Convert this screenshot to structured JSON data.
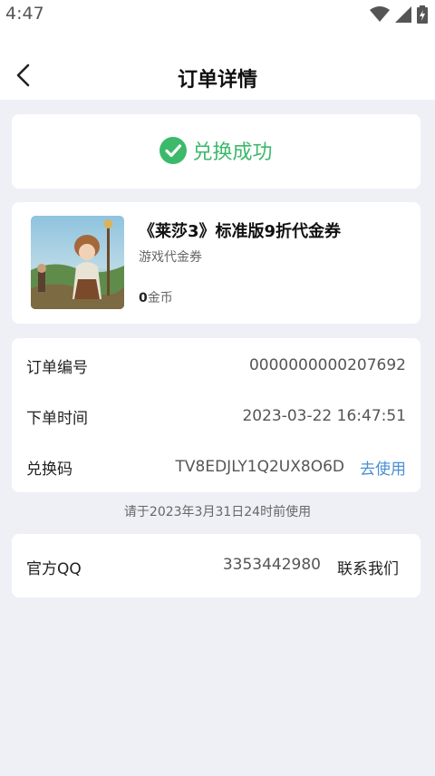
{
  "status_bar": {
    "time": "4:47"
  },
  "header": {
    "title": "订单详情"
  },
  "status": {
    "text": "兑换成功",
    "color": "#3cb96a"
  },
  "product": {
    "title": "《莱莎3》标准版9折代金券",
    "type": "游戏代金券",
    "price_amount": "0",
    "price_unit": "金币"
  },
  "order": {
    "number_label": "订单编号",
    "number_value": "0000000000207692",
    "time_label": "下单时间",
    "time_value": "2023-03-22 16:47:51",
    "code_label": "兑换码",
    "code_value": "TV8EDJLY1Q2UX8O6D",
    "use_label": "去使用"
  },
  "notice": "请于2023年3月31日24时前使用",
  "contact": {
    "label": "官方QQ",
    "value": "3353442980",
    "button": "联系我们"
  },
  "colors": {
    "accent_link": "#4a8fd6",
    "success": "#3cb96a",
    "page_bg": "#eef0f6"
  }
}
